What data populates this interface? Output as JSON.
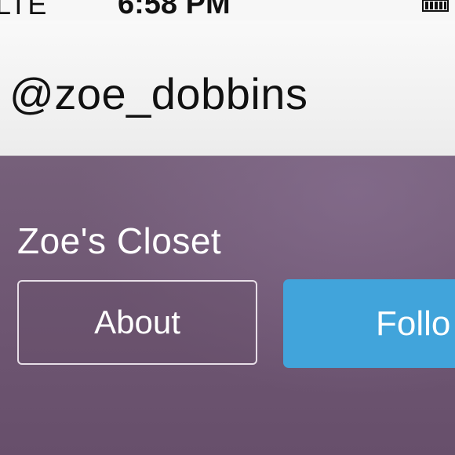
{
  "status_bar": {
    "carrier": "LTE",
    "time": "6:58 PM",
    "battery_icon": "battery-icon"
  },
  "header": {
    "username": "@zoe_dobbins"
  },
  "profile": {
    "closet_name": "Zoe's Closet",
    "about_label": "About",
    "follow_label": "Follo",
    "follow_button_color": "#41a4db",
    "banner_color": "#6e5672"
  }
}
